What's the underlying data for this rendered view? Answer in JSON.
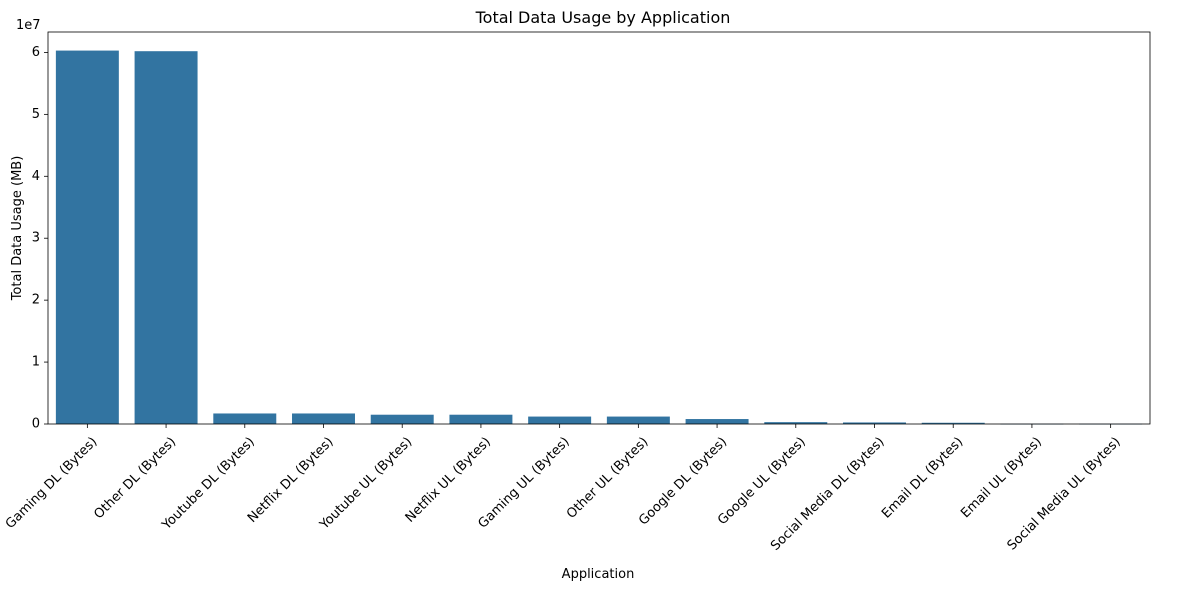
{
  "chart_data": {
    "type": "bar",
    "title": "Total Data Usage by Application",
    "xlabel": "Application",
    "ylabel": "Total Data Usage (MB)",
    "y_offset_label": "1e7",
    "ylim": [
      0,
      63300000
    ],
    "yticks": [
      0,
      10000000,
      20000000,
      30000000,
      40000000,
      50000000,
      60000000
    ],
    "ytick_labels": [
      "0",
      "1",
      "2",
      "3",
      "4",
      "5",
      "6"
    ],
    "grid": false,
    "bar_color": "#3274a1",
    "categories": [
      "Gaming DL (Bytes)",
      "Other DL (Bytes)",
      "Youtube DL (Bytes)",
      "Netflix DL (Bytes)",
      "Youtube UL (Bytes)",
      "Netflix UL (Bytes)",
      "Gaming UL (Bytes)",
      "Other UL (Bytes)",
      "Google DL (Bytes)",
      "Google UL (Bytes)",
      "Social Media DL (Bytes)",
      "Email DL (Bytes)",
      "Email UL (Bytes)",
      "Social Media UL (Bytes)"
    ],
    "values": [
      60300000,
      60200000,
      1700000,
      1700000,
      1500000,
      1500000,
      1200000,
      1200000,
      800000,
      300000,
      250000,
      200000,
      30000,
      30000
    ]
  }
}
